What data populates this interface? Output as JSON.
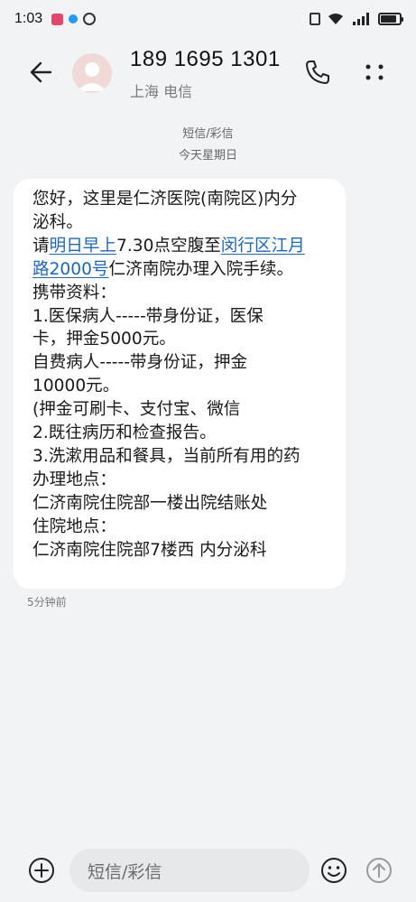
{
  "status_bar": {
    "time": "1:03",
    "battery_level": 0.85
  },
  "header": {
    "contact_number": "189 1695 1301",
    "contact_location": "上海 电信"
  },
  "conversation": {
    "channel_label": "短信/彩信",
    "date_label": "今天星期日",
    "message": {
      "lines": [
        [
          "您好，这里是仁济医院(南院区)内分"
        ],
        [
          "泌科。"
        ],
        [
          "请",
          {
            "link": "明日早上"
          },
          "7.30点空腹至",
          {
            "link": "闵行区江月"
          }
        ],
        [
          {
            "link": "路2000号"
          },
          "仁济南院办理入院手续。"
        ],
        [
          "携带资料："
        ],
        [
          "1.医保病人-----带身份证，医保"
        ],
        [
          "卡，押金5000元。"
        ],
        [
          "   自费病人-----带身份证，押金"
        ],
        [
          "10000元。"
        ],
        [
          "    (押金可刷卡、支付宝、微信"
        ],
        [
          "2.既往病历和检查报告。"
        ],
        [
          "3.洗漱用品和餐具，当前所有用的药"
        ],
        [
          "办理地点："
        ],
        [
          "仁济南院住院部一楼出院结账处"
        ],
        [
          "住院地点："
        ],
        [
          "仁济南院住院部7楼西 内分泌科"
        ]
      ],
      "time": "5分钟前"
    }
  },
  "input_bar": {
    "placeholder": "短信/彩信"
  },
  "colors": {
    "background": "#f1f3f5",
    "bubble": "#ffffff",
    "link": "#1a66c6",
    "muted_text": "#7a7a7a"
  },
  "icons": {
    "back": "arrow-left-icon",
    "call": "phone-icon",
    "more": "more-vertical-icon",
    "add": "plus-circle-icon",
    "emoji": "emoji-icon",
    "send": "arrow-up-circle-icon"
  }
}
